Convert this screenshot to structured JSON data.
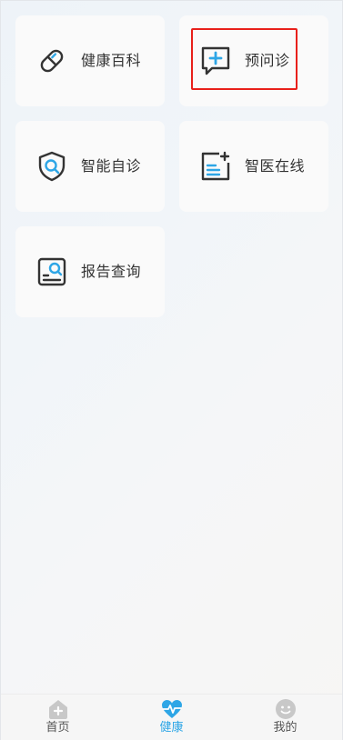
{
  "grid": [
    {
      "id": "health-wiki",
      "label": "健康百科",
      "icon": "pill-icon"
    },
    {
      "id": "pre-consultation",
      "label": "预问诊",
      "icon": "chat-plus-icon",
      "highlighted": true
    },
    {
      "id": "self-diagnosis",
      "label": "智能自诊",
      "icon": "shield-search-icon"
    },
    {
      "id": "smart-doctor",
      "label": "智医在线",
      "icon": "document-plus-icon"
    },
    {
      "id": "report-query",
      "label": "报告查询",
      "icon": "report-search-icon"
    }
  ],
  "tabbar": [
    {
      "label": "首页",
      "icon": "home-icon",
      "active": false
    },
    {
      "label": "健康",
      "icon": "heartbeat-icon",
      "active": true
    },
    {
      "label": "我的",
      "icon": "smile-icon",
      "active": false
    }
  ],
  "colors": {
    "accent": "#2ea6e6",
    "icon_stroke": "#333333",
    "highlight": "#e8201b",
    "inactive_tab": "#c8c8c8"
  }
}
